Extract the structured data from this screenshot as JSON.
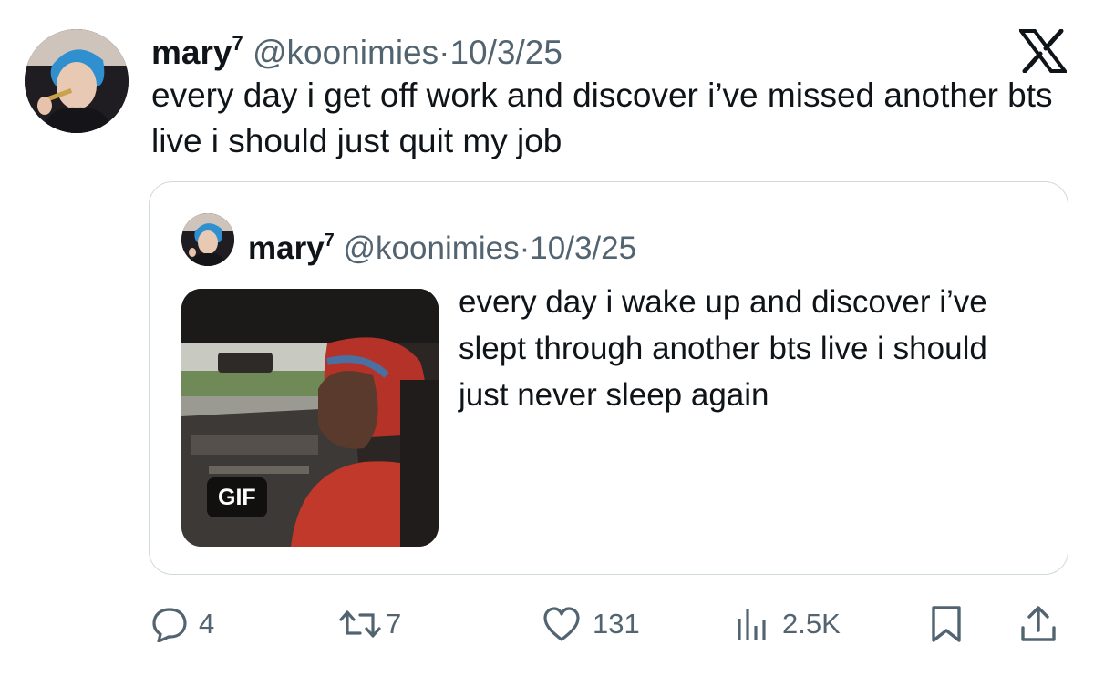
{
  "post": {
    "author_name": "mary",
    "author_superscript": "7",
    "handle": "@koonimies",
    "separator": "·",
    "date": "10/3/25",
    "text": "every day i get off work and discover i’ve missed another bts live i should just quit my job"
  },
  "quoted": {
    "author_name": "mary",
    "author_superscript": "7",
    "handle": "@koonimies",
    "separator": "·",
    "date": "10/3/25",
    "text": "every day i wake up and discover i’ve slept through another bts live i should just never sleep again",
    "media_badge": "GIF"
  },
  "actions": {
    "replies": "4",
    "reposts": "7",
    "likes": "131",
    "views": "2.5K"
  },
  "icons": {
    "platform": "x-logo-icon",
    "reply": "reply-icon",
    "repost": "repost-icon",
    "like": "heart-icon",
    "views": "views-icon",
    "bookmark": "bookmark-icon",
    "share": "share-icon"
  },
  "colors": {
    "text": "#0f1419",
    "secondary": "#536471",
    "border": "#cfd9de"
  }
}
